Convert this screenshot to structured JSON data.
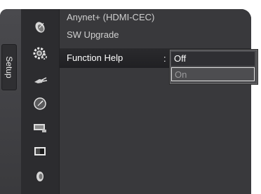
{
  "sidebar": {
    "tab_label": "Setup"
  },
  "icons": [
    "satellite-dish-icon",
    "setup-gear-icon",
    "input-plug-icon",
    "clock-icon",
    "picture-settings-icon",
    "screen-icon",
    "sound-speaker-icon"
  ],
  "menu": {
    "items": [
      {
        "label": "Anynet+ (HDMI-CEC)"
      },
      {
        "label": "SW Upgrade"
      },
      {
        "label": "Function Help"
      }
    ],
    "colon": ":"
  },
  "popup": {
    "options": [
      {
        "label": "Off"
      },
      {
        "label": "On"
      }
    ]
  }
}
